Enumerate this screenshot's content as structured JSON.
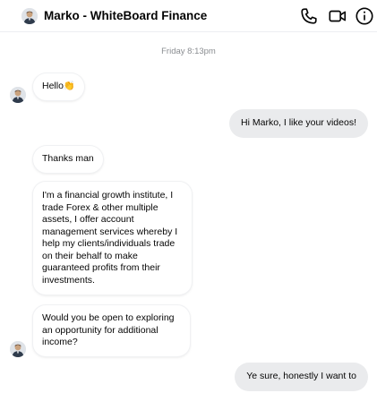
{
  "header": {
    "title": "Marko - WhiteBoard Finance",
    "icons": [
      "avatar",
      "phone-icon",
      "video-icon",
      "info-icon"
    ],
    "accent_color": "#050505"
  },
  "timestamp": "Friday 8:13pm",
  "messages": [
    {
      "side": "incoming",
      "text": "Hello👏"
    },
    {
      "side": "outgoing",
      "text": "Hi Marko, I like your videos!"
    },
    {
      "side": "incoming",
      "text": "Thanks man"
    },
    {
      "side": "incoming",
      "text": "I'm a financial growth institute, I trade Forex & other multiple assets, I offer account management services whereby I help my clients/individuals trade on their behalf to make guaranteed profits from their investments."
    },
    {
      "side": "incoming",
      "text": "Would you be open to exploring an opportunity for additional income?"
    },
    {
      "side": "outgoing",
      "text": "Ye sure, honestly I want to"
    }
  ]
}
